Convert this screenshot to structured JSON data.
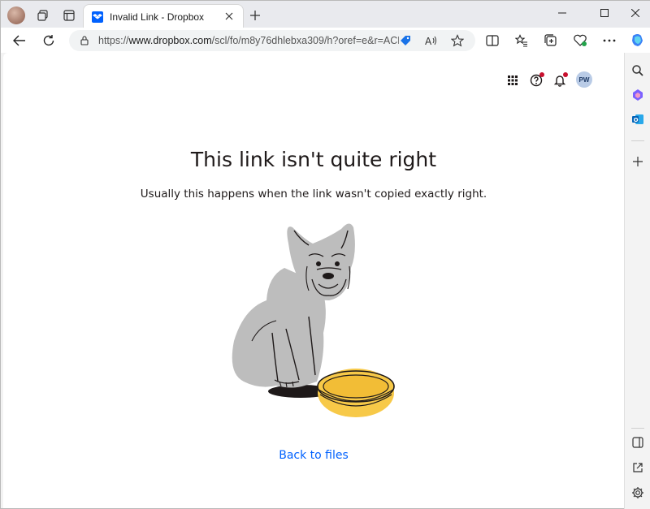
{
  "browser": {
    "tab": {
      "title": "Invalid Link - Dropbox"
    },
    "address": {
      "url_prefix": "https://",
      "url_host": "www.dropbox.com",
      "url_path": "/scl/fo/m8y76dhlebxa309/h?oref=e&r=ACD..."
    },
    "icons": {
      "profile": "profile-avatar",
      "workspaces": "workspaces-icon",
      "tab_actions": "tab-actions-icon",
      "favicon": "dropbox-favicon",
      "close": "close-icon",
      "new_tab": "plus-icon",
      "back": "back-arrow-icon",
      "refresh": "refresh-icon",
      "site_info": "site-info-icon"
    }
  },
  "page": {
    "header": {
      "avatar_initials": "PW"
    },
    "title": "This link isn't quite right",
    "subtitle": "Usually this happens when the link wasn't copied exactly right.",
    "back_link": "Back to files"
  },
  "colors": {
    "link": "#0061fe",
    "notification_dot": "#c8102e",
    "bowl": "#f7c948",
    "dog": "#bdbdbd"
  }
}
